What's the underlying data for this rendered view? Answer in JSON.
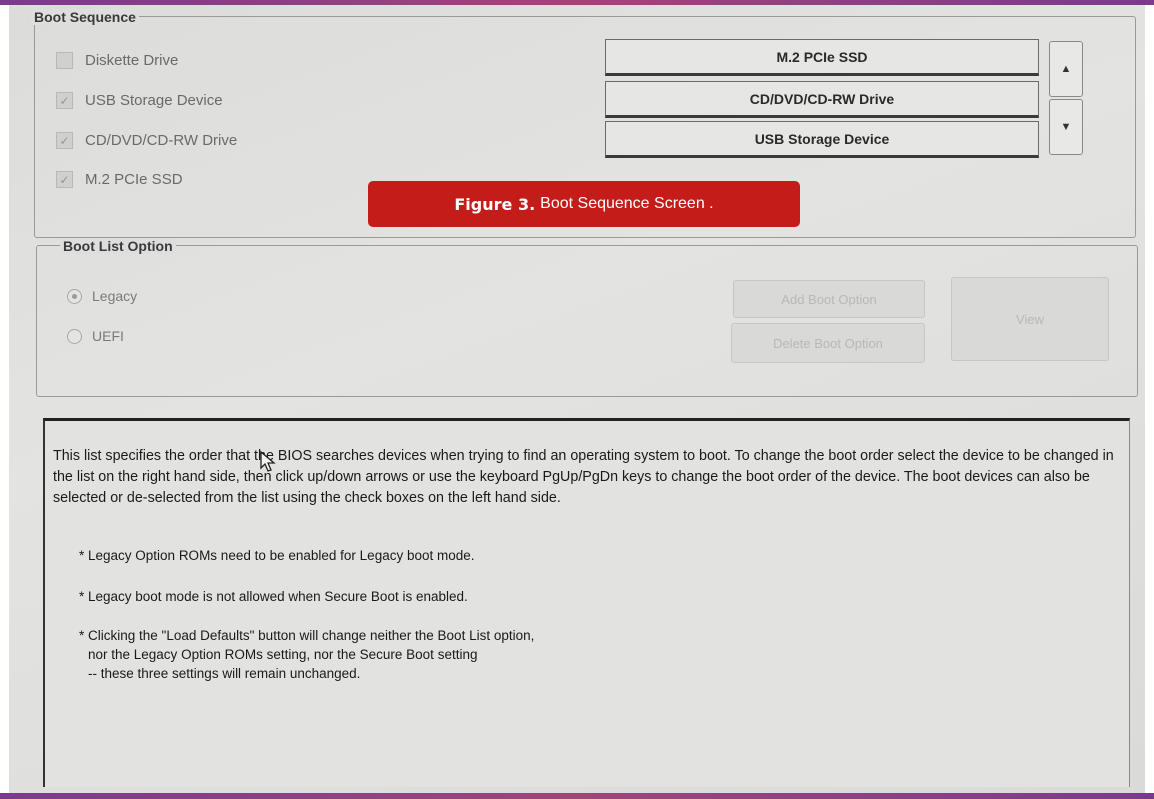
{
  "boot_sequence": {
    "legend": "Boot Sequence",
    "devices": [
      {
        "label": "Diskette Drive",
        "checked": false
      },
      {
        "label": "USB Storage Device",
        "checked": true
      },
      {
        "label": "CD/DVD/CD-RW Drive",
        "checked": true
      },
      {
        "label": "M.2 PCIe SSD",
        "checked": true
      }
    ],
    "order": [
      "M.2 PCIe SSD",
      "CD/DVD/CD-RW Drive",
      "USB Storage Device"
    ],
    "up_icon": "up-arrow-icon",
    "down_icon": "down-arrow-icon"
  },
  "caption": {
    "figure": "Figure 3.",
    "text": "Boot Sequence Screen ."
  },
  "boot_list_option": {
    "legend": "Boot List Option",
    "options": [
      {
        "label": "Legacy",
        "selected": true
      },
      {
        "label": "UEFI",
        "selected": false
      }
    ],
    "add_button": "Add Boot Option",
    "delete_button": "Delete Boot Option",
    "view_button": "View"
  },
  "description": {
    "paragraph": "This list specifies the order that the BIOS searches devices when trying to find an operating system to boot. To change the boot order select the device to be changed in the list on the right hand side, then click up/down arrows or use the keyboard PgUp/PgDn keys to change the boot order of the device. The boot devices can also be selected or de-selected from the list using the check boxes on the left hand side.",
    "note1": "* Legacy Option ROMs need to be enabled for Legacy boot mode.",
    "note2": "* Legacy boot mode is not allowed when Secure Boot is enabled.",
    "note3_line1": "* Clicking the \"Load Defaults\" button will change neither the Boot List option,",
    "note3_line2": "nor the Legacy Option ROMs setting, nor the Secure Boot setting",
    "note3_line3": "-- these three settings will remain unchanged."
  },
  "colors": {
    "caption_bg": "#c41c18",
    "frame_accent": "#7a3b8c"
  }
}
